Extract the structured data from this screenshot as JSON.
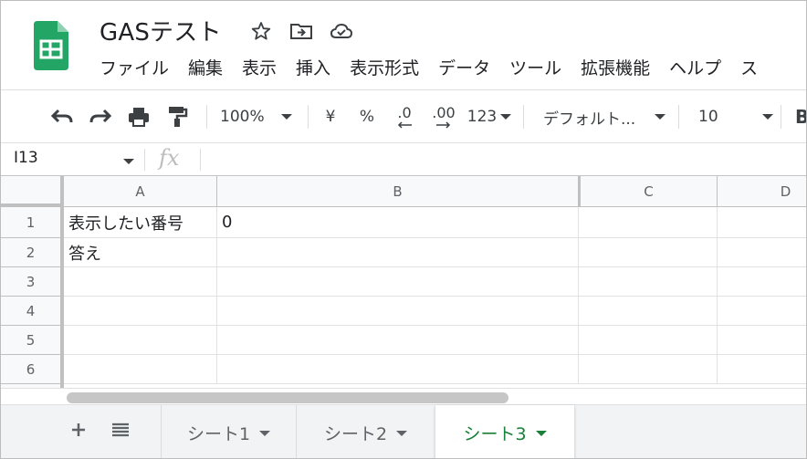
{
  "doc": {
    "title": "GASテスト"
  },
  "menu": [
    "ファイル",
    "編集",
    "表示",
    "挿入",
    "表示形式",
    "データ",
    "ツール",
    "拡張機能",
    "ヘルプ",
    "ス"
  ],
  "toolbar": {
    "zoom": "100%",
    "currency": "¥",
    "percent": "%",
    "dec_decrease": ".0",
    "dec_increase": ".00",
    "number_format": "123",
    "font": "デフォルト...",
    "font_size": "10",
    "bold": "B"
  },
  "formula_bar": {
    "name_box": "I13",
    "fx": "fx",
    "content": ""
  },
  "columns": [
    "A",
    "B",
    "C",
    "D"
  ],
  "rows": [
    {
      "num": "1",
      "a": "表示したい番号",
      "b": "0"
    },
    {
      "num": "2",
      "a": "答え",
      "b": ""
    },
    {
      "num": "3",
      "a": "",
      "b": ""
    },
    {
      "num": "4",
      "a": "",
      "b": ""
    },
    {
      "num": "5",
      "a": "",
      "b": ""
    },
    {
      "num": "6",
      "a": "",
      "b": ""
    }
  ],
  "sheets": [
    {
      "name": "シート1",
      "active": false
    },
    {
      "name": "シート2",
      "active": false
    },
    {
      "name": "シート3",
      "active": true
    }
  ],
  "colors": {
    "sheets_green": "#23a566",
    "active_tab_text": "#188038",
    "header_bg": "#f8f9fa"
  },
  "icons": {
    "logo": "google-sheets-logo",
    "star": "star-icon",
    "move": "move-to-folder-icon",
    "cloud": "cloud-saved-icon",
    "undo": "undo-icon",
    "redo": "redo-icon",
    "print": "print-icon",
    "paint": "paint-format-icon"
  }
}
